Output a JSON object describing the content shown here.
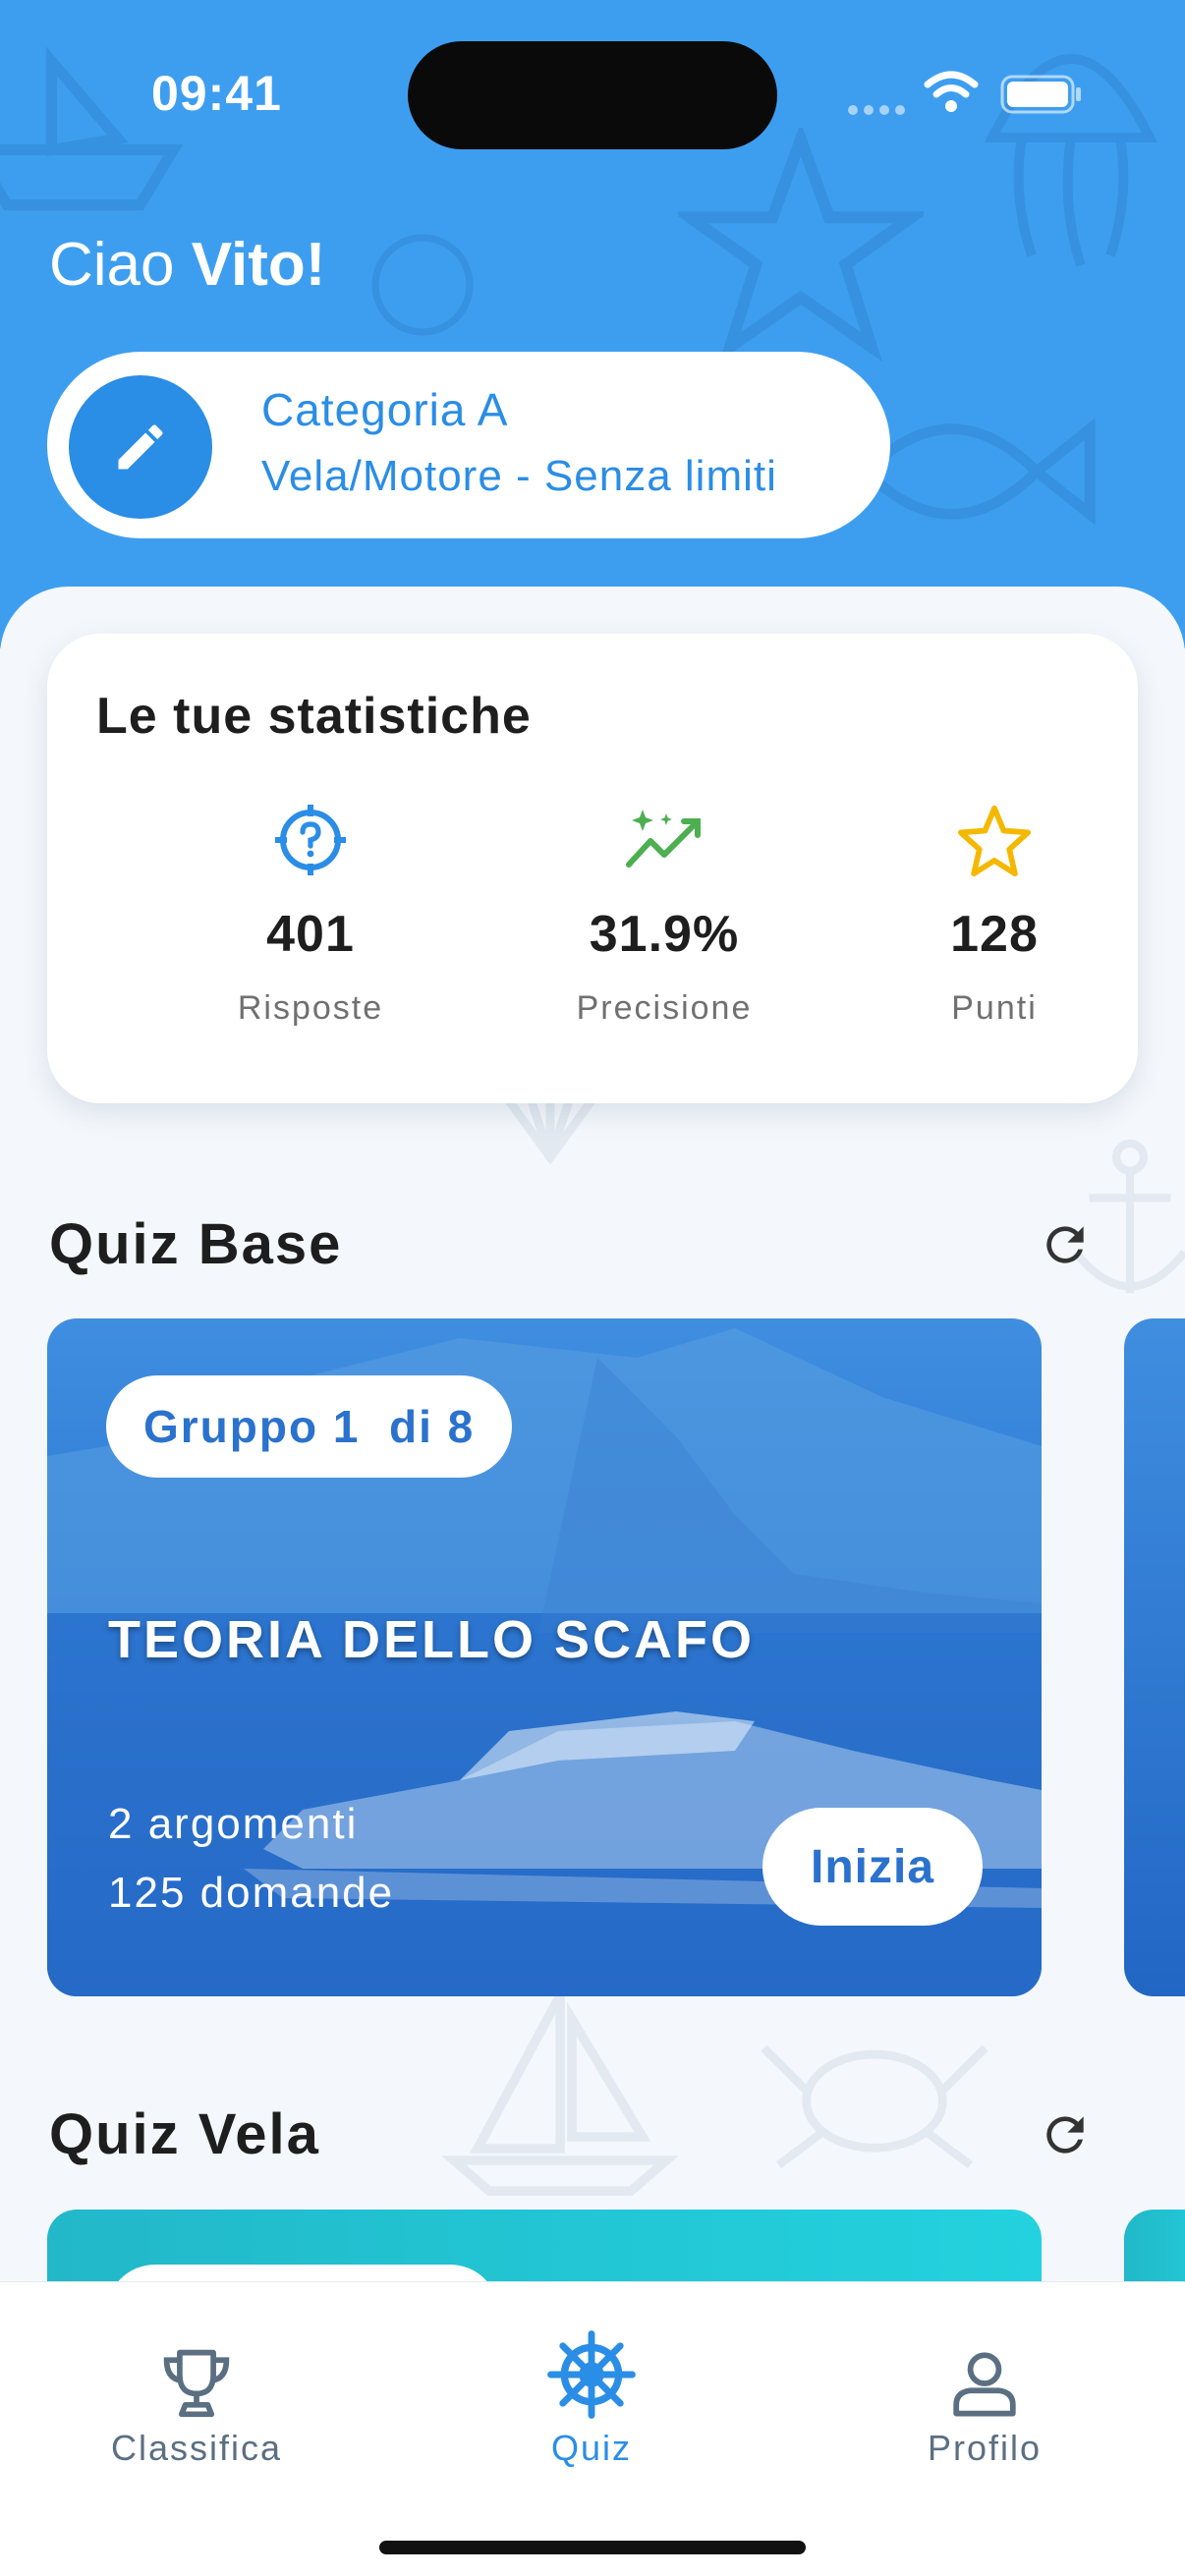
{
  "status_bar": {
    "time": "09:41"
  },
  "header": {
    "greeting_prefix": "Ciao ",
    "user_name": "Vito!",
    "category": {
      "title": "Categoria A",
      "subtitle": "Vela/Motore - Senza limiti",
      "edit_icon": "pencil-icon"
    }
  },
  "stats": {
    "title": "Le tue statistiche",
    "items": [
      {
        "value": "401",
        "label": "Risposte",
        "icon": "target-question-icon",
        "color": "#2a8de6"
      },
      {
        "value": "31.9%",
        "label": "Precisione",
        "icon": "sparkle-trend-icon",
        "color": "#4caf50"
      },
      {
        "value": "128",
        "label": "Punti",
        "icon": "star-icon",
        "color": "#f5b800"
      }
    ]
  },
  "quiz_base": {
    "title": "Quiz Base",
    "refresh_icon": "refresh-icon",
    "card": {
      "badge": "Gruppo 1  di 8",
      "title": "TEORIA DELLO SCAFO",
      "topics": "2 argomenti",
      "questions": "125 domande",
      "button": "Inizia"
    }
  },
  "quiz_vela": {
    "title": "Quiz Vela",
    "refresh_icon": "refresh-icon"
  },
  "tab_bar": {
    "active": "Quiz",
    "accent_color": "#2a8de6",
    "items": [
      {
        "label": "Classifica",
        "icon": "trophy-icon"
      },
      {
        "label": "Quiz",
        "icon": "ship-wheel-icon"
      },
      {
        "label": "Profilo",
        "icon": "person-icon"
      }
    ]
  }
}
